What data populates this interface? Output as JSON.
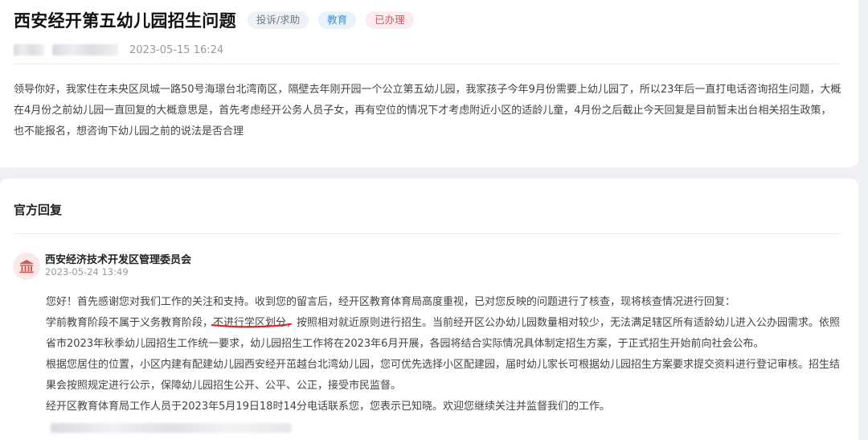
{
  "question": {
    "title": "西安经开第五幼儿园招生问题",
    "tags": {
      "category": "投诉/求助",
      "field": "教育",
      "status": "已办理"
    },
    "date": "2023-05-15 16:24",
    "body": "领导你好，我家住在未央区凤城一路50号海璟台北湾南区，隔壁去年刚开园一个公立第五幼儿园，我家孩子今年9月份需要上幼儿园了，所以23年后一直打电话咨询招生问题，大概在4月份之前幼儿园一直回复的大概意思是，首先考虑经开公务人员子女，再有空位的情况下才考虑附近小区的适龄儿童，4月份之后截止今天回复是目前暂未出台相关招生政策，也不能报名，想咨询下幼儿园之前的说法是否合理"
  },
  "official_reply": {
    "section_title": "官方回复",
    "department": "西安经济技术开发区管理委员会",
    "date": "2023-05-24 13:49",
    "paragraphs": {
      "p1": "您好！首先感谢您对我们工作的关注和支持。收到您的留言后，经开区教育体育局高度重视，已对您反映的问题进行了核查，现将核查情况进行回复：",
      "p2_before": "学前教育阶段不属于义务教育阶段，",
      "p2_underlined": "不进行学区划分，按照相对就近原则进行招生",
      "p2_after": "。当前经开区公办幼儿园数量相对较少，无法满足辖区所有适龄幼儿进入公办园需求。依照省市2023年秋季幼儿园招生工作统一要求，幼儿园招生工作将在2023年6月开展，各园将结合实际情况具体制定招生方案，于正式招生开始前向社会公布。",
      "p3": "根据您居住的位置，小区内建有配建幼儿园西安经开茁越台北湾幼儿园，您可优先选择小区配建园，届时幼儿家长可根据幼儿园招生方案要求提交资料进行登记审核。招生结果会按照规定进行公示，保障幼儿园招生公开、公平、公正，接受市民监督。",
      "p4": "经开区教育体育局工作人员于2023年5月19日18时14分电话联系您，您表示已知晓。欢迎您继续关注并监督我们的工作。"
    }
  },
  "icons": {
    "department_icon": "government-building-icon"
  },
  "colors": {
    "tag_status": "#e0505d",
    "tag_field": "#3d8fd6",
    "underline_scribble": "#e5232a"
  }
}
